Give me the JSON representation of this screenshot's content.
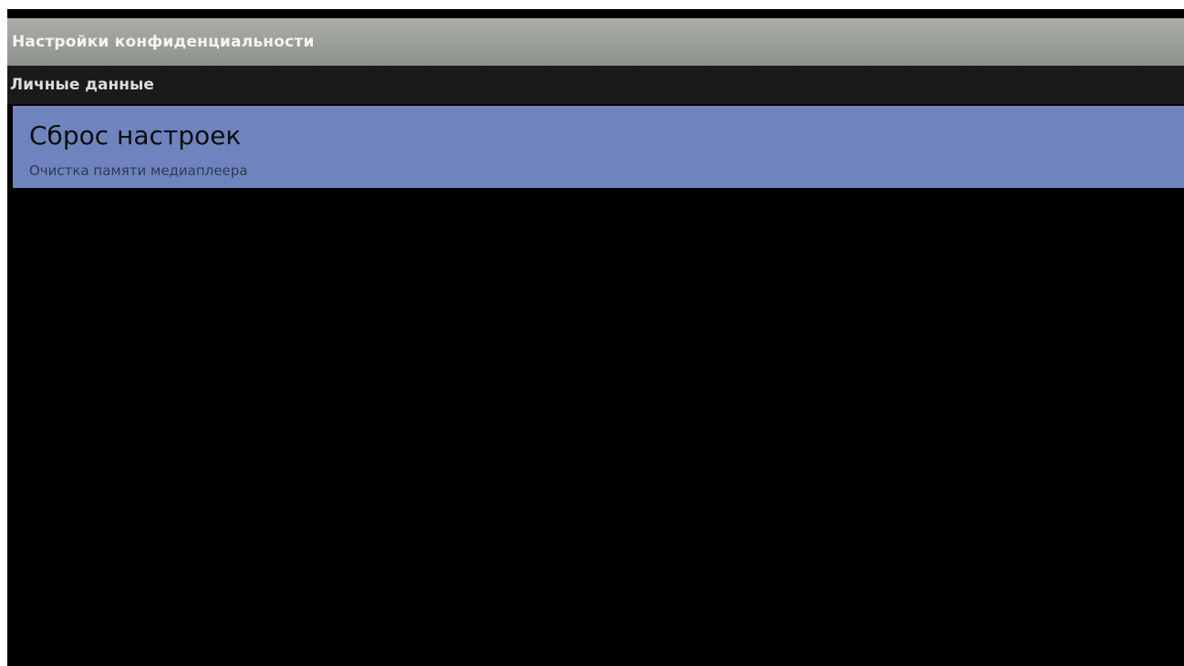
{
  "window": {
    "title": "Настройки конфиденциальности"
  },
  "section": {
    "label": "Личные данные"
  },
  "items": [
    {
      "title": "Сброс настроек",
      "summary": "Очистка памяти медиаплеера",
      "selected": true
    }
  ],
  "colors": {
    "titlebar": "#9c9f9a",
    "section_header": "#1a1a1a",
    "selected_item": "#6f84be",
    "background": "#000000"
  }
}
